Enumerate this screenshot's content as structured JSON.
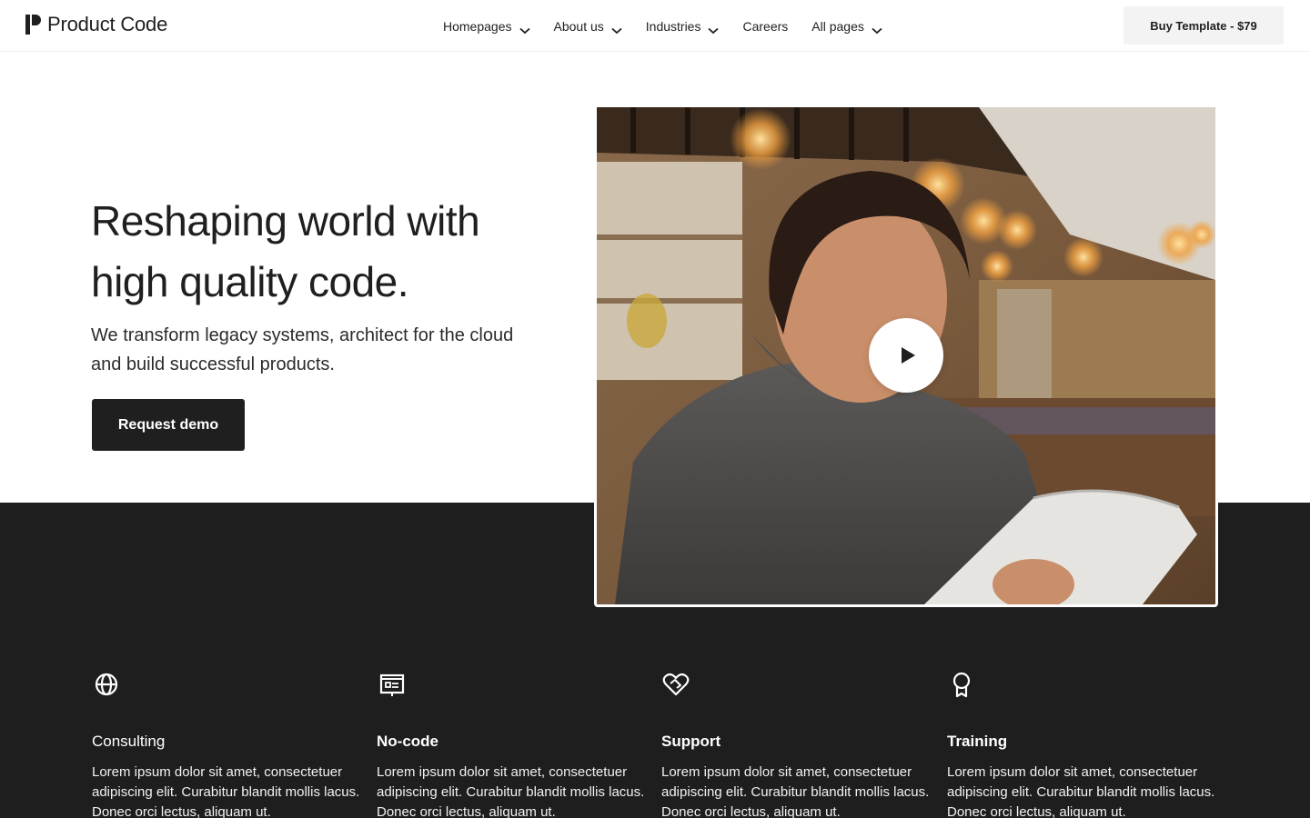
{
  "header": {
    "logo_text": "Product Code",
    "nav": [
      {
        "label": "Homepages",
        "has_dropdown": true
      },
      {
        "label": "About us",
        "has_dropdown": true
      },
      {
        "label": "Industries",
        "has_dropdown": true
      },
      {
        "label": "Careers",
        "has_dropdown": false
      },
      {
        "label": "All pages",
        "has_dropdown": true
      }
    ],
    "buy_button": "Buy Template - $79"
  },
  "hero": {
    "title_line1": "Reshaping world with",
    "title_line2": "high quality code.",
    "subtitle": "We transform legacy systems, architect for the cloud and build successful products.",
    "cta": "Request demo",
    "video_icon": "play-icon"
  },
  "features": [
    {
      "icon": "globe-icon",
      "title": "Consulting",
      "description": "Lorem ipsum dolor sit amet, consectetuer adipiscing elit. Curabitur blandit mollis lacus. Donec orci lectus, aliquam ut."
    },
    {
      "icon": "presentation-icon",
      "title": "No-code",
      "description": "Lorem ipsum dolor sit amet, consectetuer adipiscing elit. Curabitur blandit mollis lacus. Donec orci lectus, aliquam ut."
    },
    {
      "icon": "heart-handshake-icon",
      "title": "Support",
      "description": "Lorem ipsum dolor sit amet, consectetuer adipiscing elit. Curabitur blandit mollis lacus. Donec orci lectus, aliquam ut."
    },
    {
      "icon": "award-icon",
      "title": "Training",
      "description": "Lorem ipsum dolor sit amet, consectetuer adipiscing elit. Curabitur blandit mollis lacus. Donec orci lectus, aliquam ut."
    }
  ],
  "colors": {
    "dark_section": "#1e1e1e",
    "button_dark": "#1f1f1f",
    "buy_button_bg": "#f3f3f3",
    "text": "#1f1f1f"
  }
}
